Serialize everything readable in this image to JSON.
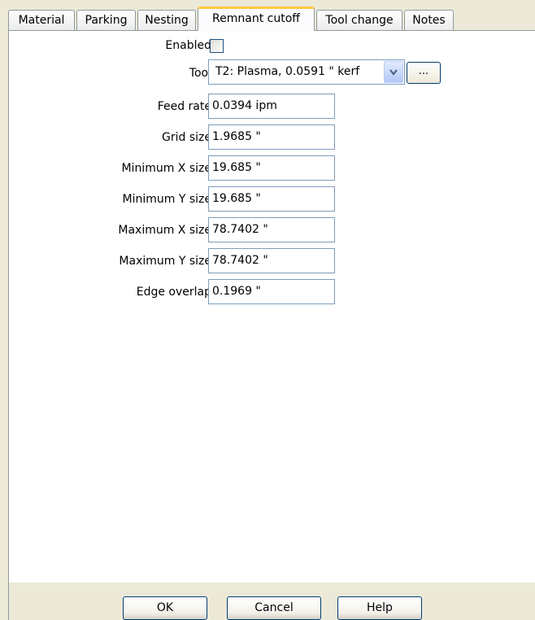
{
  "tabs": [
    {
      "label": "Material"
    },
    {
      "label": "Parking"
    },
    {
      "label": "Nesting"
    },
    {
      "label": "Remnant cutoff",
      "active": true
    },
    {
      "label": "Tool change"
    },
    {
      "label": "Notes"
    }
  ],
  "form": {
    "enabled_label": "Enabled",
    "enabled_checked": false,
    "tool_label": "Tool",
    "tool_value": "T2: Plasma, 0.0591 \" kerf",
    "tool_browse_label": "...",
    "fields": [
      {
        "label": "Feed rate",
        "value": "0.0394 ipm"
      },
      {
        "label": "Grid size",
        "value": "1.9685 \""
      },
      {
        "label": "Minimum X size",
        "value": "19.685 \""
      },
      {
        "label": "Minimum Y size",
        "value": "19.685 \""
      },
      {
        "label": "Maximum X size",
        "value": "78.7402 \""
      },
      {
        "label": "Maximum Y size",
        "value": "78.7402 \""
      },
      {
        "label": "Edge overlap",
        "value": "0.1969 \""
      }
    ]
  },
  "buttons": {
    "ok": "OK",
    "cancel": "Cancel",
    "help": "Help"
  },
  "colors": {
    "active_tab_highlight": "#ffc83c",
    "dialog_background": "#ece9d8",
    "field_border": "#7f9db9"
  },
  "icons": {
    "dropdown": "chevron-down-icon"
  }
}
